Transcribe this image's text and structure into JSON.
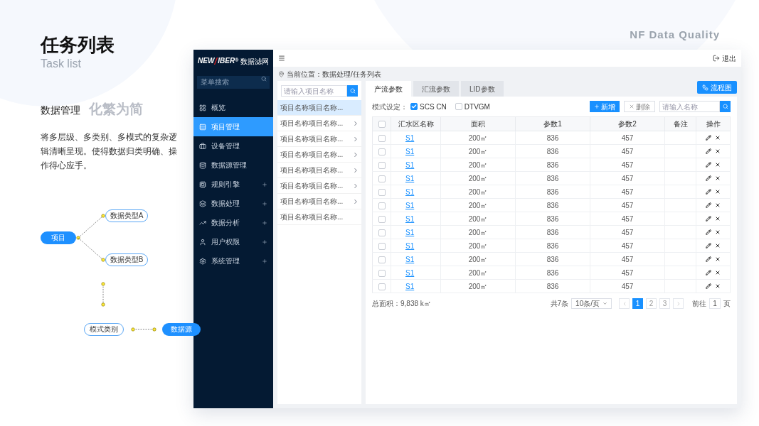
{
  "slide": {
    "title": "任务列表",
    "subtitle": "Task list",
    "brand": "NF Data Quality",
    "section": "数据管理",
    "slogan": "化繁为简",
    "description": "将多层级、多类别、多模式的复杂逻辑清晰呈现。使得数据归类明确、操作得心应手。"
  },
  "diagram": {
    "root": "项目",
    "branches": [
      "数据类型A",
      "数据类型B"
    ],
    "mode": "模式类别",
    "source": "数据源"
  },
  "app": {
    "logo": [
      "NEW",
      "IBER",
      "®"
    ],
    "product": "数据滤网",
    "menu_search": {
      "placeholder": "菜单搜索"
    },
    "menu": [
      {
        "label": "概览",
        "selected": false,
        "expandable": false
      },
      {
        "label": "项目管理",
        "selected": true,
        "expandable": false
      },
      {
        "label": "设备管理",
        "selected": false,
        "expandable": false
      },
      {
        "label": "数据源管理",
        "selected": false,
        "expandable": false
      },
      {
        "label": "规则引擎",
        "selected": false,
        "expandable": true
      },
      {
        "label": "数据处理",
        "selected": false,
        "expandable": true
      },
      {
        "label": "数据分析",
        "selected": false,
        "expandable": true
      },
      {
        "label": "用户权限",
        "selected": false,
        "expandable": true
      },
      {
        "label": "系统管理",
        "selected": false,
        "expandable": true
      }
    ],
    "logout": "退出",
    "breadcrumb": "当前位置：数据处理/任务列表",
    "project_search": {
      "placeholder": "请输入项目名称"
    },
    "projects": [
      {
        "label": "项目名称项目名称...",
        "selected": true,
        "expandable": false
      },
      {
        "label": "项目名称项目名称...",
        "selected": false,
        "expandable": true
      },
      {
        "label": "项目名称项目名称...",
        "selected": false,
        "expandable": true
      },
      {
        "label": "项目名称项目名称...",
        "selected": false,
        "expandable": true
      },
      {
        "label": "项目名称项目名称...",
        "selected": false,
        "expandable": true
      },
      {
        "label": "项目名称项目名称...",
        "selected": false,
        "expandable": true
      },
      {
        "label": "项目名称项目名称...",
        "selected": false,
        "expandable": true
      },
      {
        "label": "项目名称项目名称...",
        "selected": false,
        "expandable": false
      }
    ],
    "tabs": [
      {
        "label": "产流参数",
        "selected": true
      },
      {
        "label": "汇流参数",
        "selected": false
      },
      {
        "label": "LID参数",
        "selected": false
      }
    ],
    "flow_button": "流程图",
    "mode_label": "模式设定：",
    "modes": [
      {
        "label": "SCS CN",
        "checked": true
      },
      {
        "label": "DTVGM",
        "checked": false
      }
    ],
    "add_button": "新增",
    "delete_button": "删除",
    "name_search": {
      "placeholder": "请输入名称"
    },
    "table": {
      "select_all": {
        "checked": false
      },
      "columns": [
        "汇水区名称",
        "面积",
        "参数1",
        "参数2",
        "备注",
        "操作"
      ],
      "rows": [
        {
          "checked": false,
          "name": "S1",
          "area": "200㎡",
          "param1": "836",
          "param2": "457"
        },
        {
          "checked": false,
          "name": "S1",
          "area": "200㎡",
          "param1": "836",
          "param2": "457"
        },
        {
          "checked": false,
          "name": "S1",
          "area": "200㎡",
          "param1": "836",
          "param2": "457"
        },
        {
          "checked": false,
          "name": "S1",
          "area": "200㎡",
          "param1": "836",
          "param2": "457"
        },
        {
          "checked": false,
          "name": "S1",
          "area": "200㎡",
          "param1": "836",
          "param2": "457"
        },
        {
          "checked": false,
          "name": "S1",
          "area": "200㎡",
          "param1": "836",
          "param2": "457"
        },
        {
          "checked": false,
          "name": "S1",
          "area": "200㎡",
          "param1": "836",
          "param2": "457"
        },
        {
          "checked": false,
          "name": "S1",
          "area": "200㎡",
          "param1": "836",
          "param2": "457"
        },
        {
          "checked": false,
          "name": "S1",
          "area": "200㎡",
          "param1": "836",
          "param2": "457"
        },
        {
          "checked": false,
          "name": "S1",
          "area": "200㎡",
          "param1": "836",
          "param2": "457"
        },
        {
          "checked": false,
          "name": "S1",
          "area": "200㎡",
          "param1": "836",
          "param2": "457"
        },
        {
          "checked": false,
          "name": "S1",
          "area": "200㎡",
          "param1": "836",
          "param2": "457"
        }
      ]
    },
    "total_area": "总面积：9,838 k㎡",
    "pagination": {
      "total": "共7条",
      "page_size": "10条/页",
      "pages": [
        {
          "label": "1",
          "selected": true
        },
        {
          "label": "2",
          "selected": false
        },
        {
          "label": "3",
          "selected": false
        }
      ],
      "goto_label": "前往",
      "goto_value": "1",
      "goto_suffix": "页"
    }
  }
}
